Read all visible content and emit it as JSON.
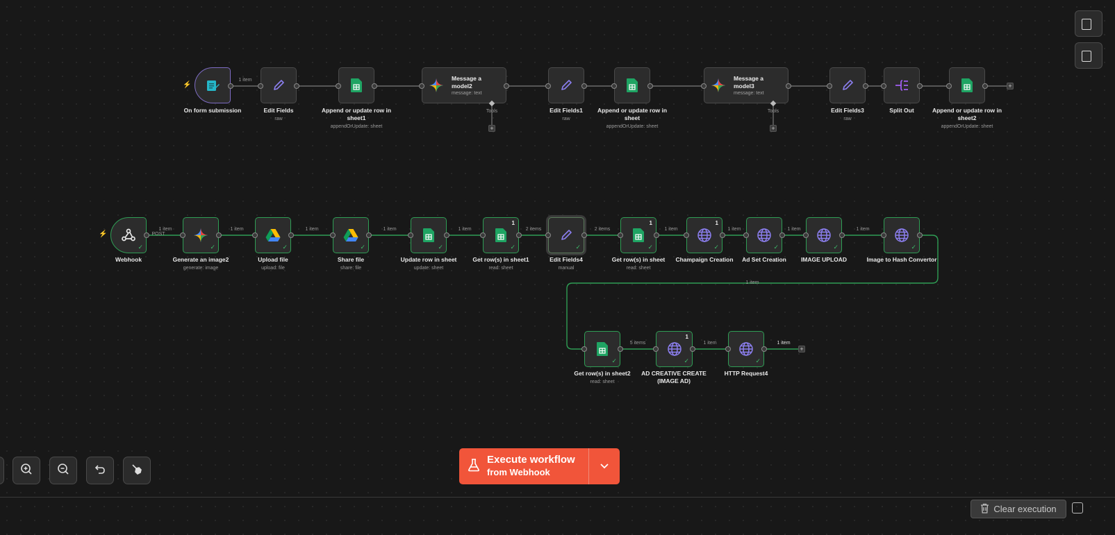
{
  "workflow1": {
    "nodes": {
      "form": {
        "label": "On form submission",
        "sub": ""
      },
      "edit": {
        "label": "Edit Fields",
        "sub": "raw"
      },
      "append1": {
        "label": "Append or update row in sheet1",
        "sub": "appendOrUpdate: sheet"
      },
      "msg2": {
        "title": "Message a model2",
        "sub": "message: text",
        "tools": "Tools"
      },
      "edit1": {
        "label": "Edit Fields1",
        "sub": "raw"
      },
      "append": {
        "label": "Append or update row in sheet",
        "sub": "appendOrUpdate: sheet"
      },
      "msg3": {
        "title": "Message a model3",
        "sub": "message: text",
        "tools": "Tools"
      },
      "edit3": {
        "label": "Edit Fields3",
        "sub": "raw"
      },
      "split": {
        "label": "Split Out",
        "sub": ""
      },
      "append2": {
        "label": "Append or update row in sheet2",
        "sub": "appendOrUpdate: sheet"
      }
    },
    "edge_labels": {
      "form_edit": "1 item"
    }
  },
  "workflow2": {
    "nodes": {
      "webhook": {
        "label": "Webhook",
        "sub": "",
        "method": "POST"
      },
      "genimg": {
        "label": "Generate an image2",
        "sub": "generate: image"
      },
      "upload": {
        "label": "Upload file",
        "sub": "upload: file"
      },
      "share": {
        "label": "Share file",
        "sub": "share: file"
      },
      "updrow": {
        "label": "Update row in sheet",
        "sub": "update: sheet"
      },
      "getrows1": {
        "label": "Get row(s) in sheet1",
        "sub": "read: sheet",
        "badge": "1"
      },
      "edit4": {
        "label": "Edit Fields4",
        "sub": "manual"
      },
      "getrows": {
        "label": "Get row(s) in sheet",
        "sub": "read: sheet",
        "badge": "1"
      },
      "champ": {
        "label": "Champaign Creation",
        "sub": "",
        "badge": "1"
      },
      "adset": {
        "label": "Ad Set Creation",
        "sub": ""
      },
      "imgup": {
        "label": "IMAGE UPLOAD",
        "sub": ""
      },
      "hash": {
        "label": "Image to Hash Convertor",
        "sub": ""
      },
      "getrows2": {
        "label": "Get row(s) in sheet2",
        "sub": "read: sheet"
      },
      "adcreative": {
        "label": "AD CREATIVE CREATE (IMAGE AD)",
        "sub": "",
        "badge": "1"
      },
      "http4": {
        "label": "HTTP Request4",
        "sub": ""
      }
    },
    "edge_labels": {
      "webhook_gen": "1 item",
      "gen_upload": "1 item",
      "upload_share": "1 item",
      "share_update": "1 item",
      "update_get1": "1 item",
      "get1_edit4": "2 items",
      "edit4_get": "2 items",
      "get_champ": "1 item",
      "champ_adset": "1 item",
      "adset_imgup": "1 item",
      "imgup_hash": "1 item",
      "hash_get2": "1 item",
      "get2_adcreative": "5 items",
      "adcreative_http": "1 item",
      "http_out": "1 item"
    }
  },
  "execute_button": {
    "line1": "Execute workflow",
    "line2": "from Webhook"
  },
  "footer": {
    "clear_label": "Clear execution"
  },
  "icons": {
    "zoom_in": "zoom-in-icon",
    "zoom_out": "zoom-out-icon",
    "undo": "undo-icon",
    "tidy": "broom-icon",
    "flask": "flask-icon"
  },
  "colors": {
    "accent": "#f1553a",
    "success": "#2f9e55",
    "background": "#181818"
  }
}
